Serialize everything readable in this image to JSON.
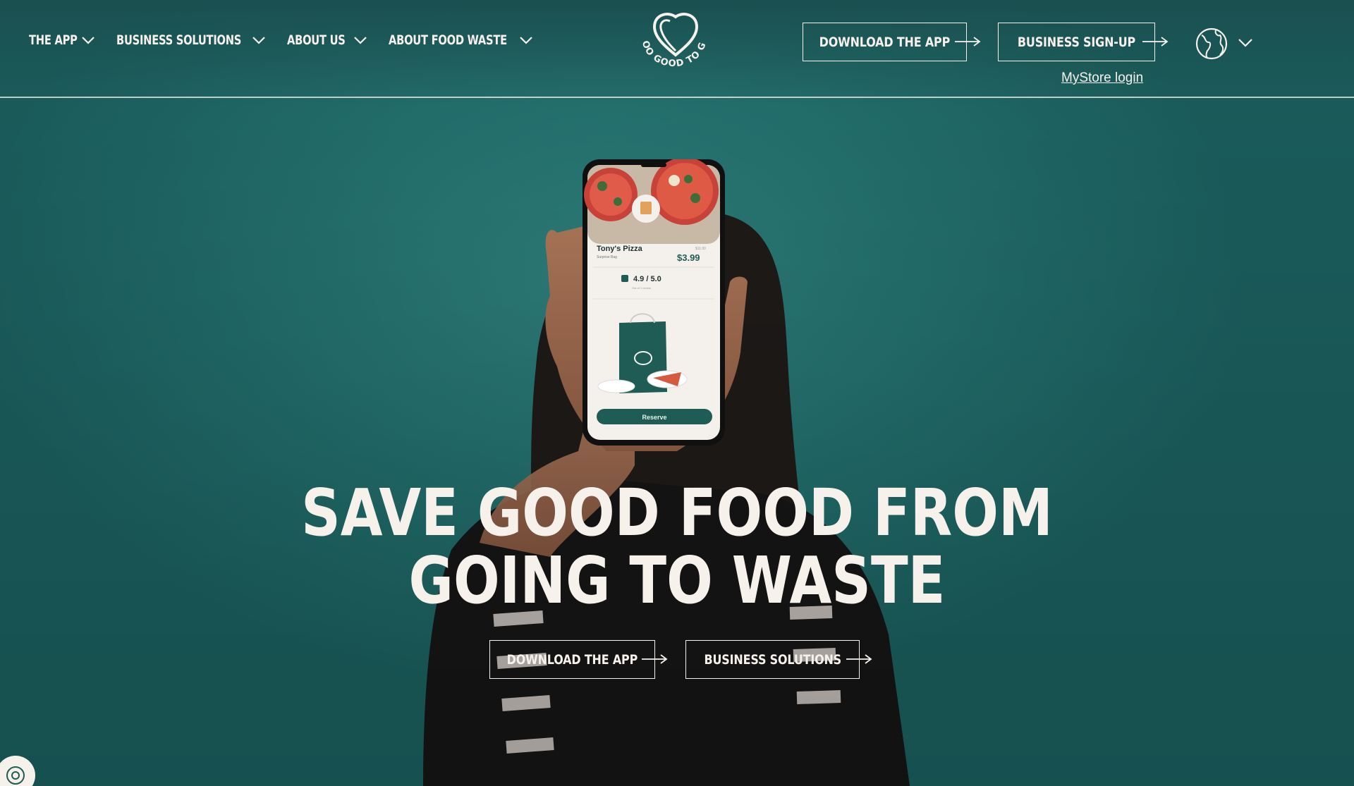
{
  "nav": {
    "items": [
      {
        "label": "THE APP"
      },
      {
        "label": "BUSINESS SOLUTIONS"
      },
      {
        "label": "ABOUT US"
      },
      {
        "label": "ABOUT FOOD WASTE"
      }
    ],
    "logo_text": "TOO GOOD TO GO",
    "download_label": "DOWNLOAD THE APP",
    "business_signup_label": "BUSINESS SIGN-UP",
    "mystore_label": "MyStore login"
  },
  "phone": {
    "store_name": "Tony's Pizza",
    "store_subtitle": "Surprise Bag",
    "old_price": "$11.00",
    "price": "$3.99",
    "rating": "4.9 / 5.0",
    "rating_sub": "Out of 1 review",
    "reserve_label": "Reserve"
  },
  "hero": {
    "headline_line1": "SAVE GOOD FOOD FROM",
    "headline_line2": "GOING TO WASTE",
    "cta_download": "DOWNLOAD THE APP",
    "cta_business": "BUSINESS SOLUTIONS"
  },
  "colors": {
    "background": "#236f6d",
    "text": "#f7f1ec",
    "accent_dark": "#1f5c55"
  }
}
